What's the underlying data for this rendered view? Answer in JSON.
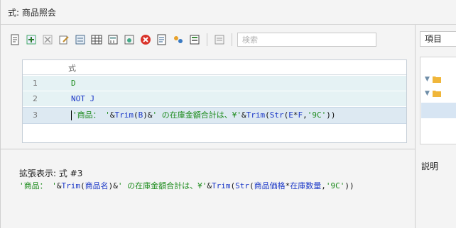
{
  "window": {
    "title": "式: 商品照会"
  },
  "toolbar": {
    "icons": [
      "new-icon",
      "insert-icon",
      "delete-icon",
      "edit-icon",
      "field-icon",
      "table-icon",
      "calc-icon",
      "format-icon",
      "clear-icon",
      "function-icon",
      "variable-icon",
      "parameter-icon",
      "print-icon"
    ],
    "search_placeholder": "検索"
  },
  "editor": {
    "column_header": "式",
    "rows": [
      {
        "num": "1",
        "code": "D"
      },
      {
        "num": "2",
        "code": "NOT J"
      },
      {
        "num": "3",
        "code": "'商品： '&Trim(B)&' の在庫金額合計は、¥'&Trim(Str(E*F,'9C'))"
      }
    ]
  },
  "expanded": {
    "title": "拡張表示: 式 #3",
    "text": "'商品： '&Trim(商品名)&' の在庫金額合計は、¥'&Trim(Str(商品価格*在庫数量,'9C'))"
  },
  "right_panel": {
    "header": "項目",
    "description_label": "説明"
  },
  "colors": {
    "string_literal": "#1a8a1a",
    "field_ref": "#1a37c7",
    "selected_row": "#dde9f2"
  }
}
